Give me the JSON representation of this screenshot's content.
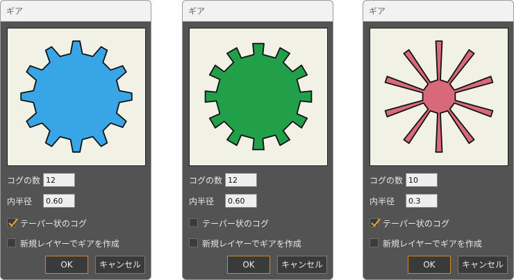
{
  "dialogs": [
    {
      "title": "ギア",
      "cog_count_label": "コグの数",
      "cog_count": "12",
      "inner_radius_label": "内半径",
      "inner_radius": "0.60",
      "taper_label": "テーパー状のコグ",
      "taper_checked": true,
      "new_layer_label": "新規レイヤーでギアを作成",
      "new_layer_checked": false,
      "ok_label": "OK",
      "cancel_label": "キャンセル",
      "gear": {
        "fill": "#37a5e6",
        "cogs": 12,
        "inner_radius": 0.6,
        "tapered": true
      }
    },
    {
      "title": "ギア",
      "cog_count_label": "コグの数",
      "cog_count": "12",
      "inner_radius_label": "内半径",
      "inner_radius": "0.60",
      "taper_label": "テーパー状のコグ",
      "taper_checked": false,
      "new_layer_label": "新規レイヤーでギアを作成",
      "new_layer_checked": false,
      "ok_label": "OK",
      "cancel_label": "キャンセル",
      "gear": {
        "fill": "#21a049",
        "cogs": 12,
        "inner_radius": 0.6,
        "tapered": false
      }
    },
    {
      "title": "ギア",
      "cog_count_label": "コグの数",
      "cog_count": "10",
      "inner_radius_label": "内半径",
      "inner_radius": "0.3",
      "taper_label": "テーパー状のコグ",
      "taper_checked": true,
      "new_layer_label": "新規レイヤーでギアを作成",
      "new_layer_checked": false,
      "ok_label": "OK",
      "cancel_label": "キャンセル",
      "gear": {
        "fill": "#d9697a",
        "cogs": 10,
        "inner_radius": 0.3,
        "tapered": true
      }
    }
  ],
  "colors": {
    "checkmark": "#e8a33a",
    "ok_border": "#d6891e",
    "preview_bg": "#f2f1e6"
  }
}
